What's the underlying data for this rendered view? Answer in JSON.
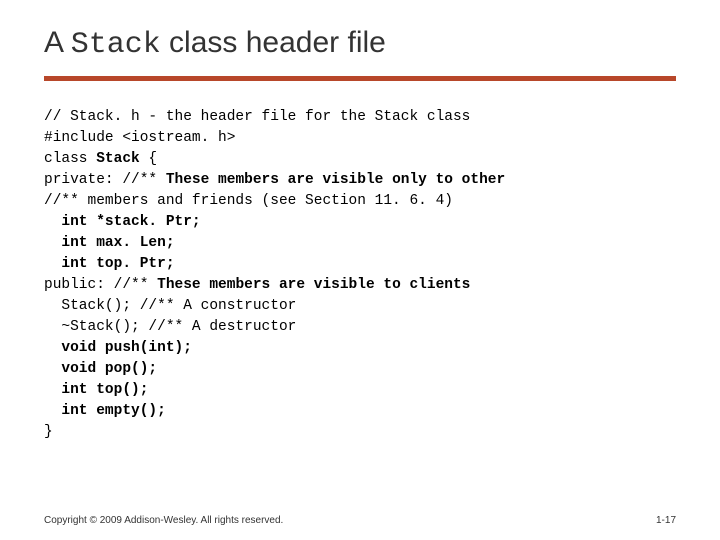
{
  "title": {
    "prefix": "A ",
    "mono": "Stack",
    "suffix": " class header file"
  },
  "code_lines": [
    {
      "indent": 0,
      "segments": [
        {
          "bold": false,
          "text": "// Stack. h - the header file for the Stack class"
        }
      ]
    },
    {
      "indent": 0,
      "segments": [
        {
          "bold": false,
          "text": "#include <iostream. h>"
        }
      ]
    },
    {
      "indent": 0,
      "segments": [
        {
          "bold": false,
          "text": "class "
        },
        {
          "bold": true,
          "text": "Stack"
        },
        {
          "bold": false,
          "text": " {"
        }
      ]
    },
    {
      "indent": 0,
      "segments": [
        {
          "bold": false,
          "text": "private: //** "
        },
        {
          "bold": true,
          "text": "These members are visible only to other"
        }
      ]
    },
    {
      "indent": 0,
      "segments": [
        {
          "bold": false,
          "text": "//** members and friends (see Section 11. 6. 4)"
        }
      ]
    },
    {
      "indent": 1,
      "segments": [
        {
          "bold": true,
          "text": "int *stack. Ptr;"
        }
      ]
    },
    {
      "indent": 1,
      "segments": [
        {
          "bold": true,
          "text": "int max. Len;"
        }
      ]
    },
    {
      "indent": 1,
      "segments": [
        {
          "bold": true,
          "text": "int top. Ptr;"
        }
      ]
    },
    {
      "indent": 0,
      "segments": [
        {
          "bold": false,
          "text": "public: //** "
        },
        {
          "bold": true,
          "text": "These members are visible to clients"
        }
      ]
    },
    {
      "indent": 1,
      "segments": [
        {
          "bold": false,
          "text": "Stack(); //** A constructor"
        }
      ]
    },
    {
      "indent": 1,
      "segments": [
        {
          "bold": false,
          "text": "~Stack(); //** A destructor"
        }
      ]
    },
    {
      "indent": 1,
      "segments": [
        {
          "bold": true,
          "text": "void push(int);"
        }
      ]
    },
    {
      "indent": 1,
      "segments": [
        {
          "bold": true,
          "text": "void pop();"
        }
      ]
    },
    {
      "indent": 1,
      "segments": [
        {
          "bold": true,
          "text": "int top();"
        }
      ]
    },
    {
      "indent": 1,
      "segments": [
        {
          "bold": true,
          "text": "int empty();"
        }
      ]
    },
    {
      "indent": 0,
      "segments": [
        {
          "bold": false,
          "text": "}"
        }
      ]
    }
  ],
  "footer": {
    "copyright": "Copyright © 2009 Addison-Wesley. All rights reserved.",
    "page": "1-17"
  }
}
